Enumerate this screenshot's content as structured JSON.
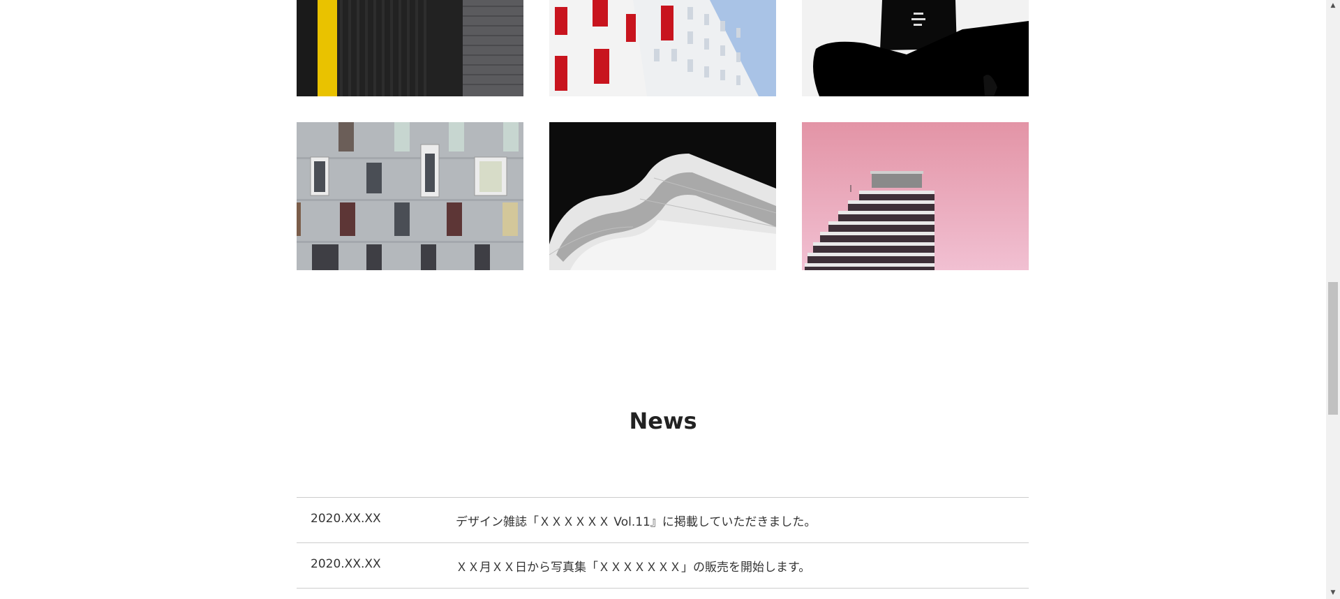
{
  "gallery": {
    "images": [
      {
        "name": "dark-facade-yellow-stripe"
      },
      {
        "name": "white-building-red-windows"
      },
      {
        "name": "black-white-chair-sign"
      },
      {
        "name": "grey-wall-windows"
      },
      {
        "name": "curved-white-building"
      },
      {
        "name": "pink-sky-tower"
      }
    ]
  },
  "news": {
    "title": "News",
    "items": [
      {
        "date": "2020.XX.XX",
        "text": "デザイン雑誌「ＸＸＸＸＸＸ Vol.11』に掲載していただきました。"
      },
      {
        "date": "2020.XX.XX",
        "text": "ＸＸ月ＸＸ日から写真集「ＸＸＸＸＸＸＸ」の販売を開始します。"
      }
    ]
  },
  "scrollbar": {
    "up_icon": "chevron-up-icon",
    "down_icon": "chevron-down-icon"
  }
}
